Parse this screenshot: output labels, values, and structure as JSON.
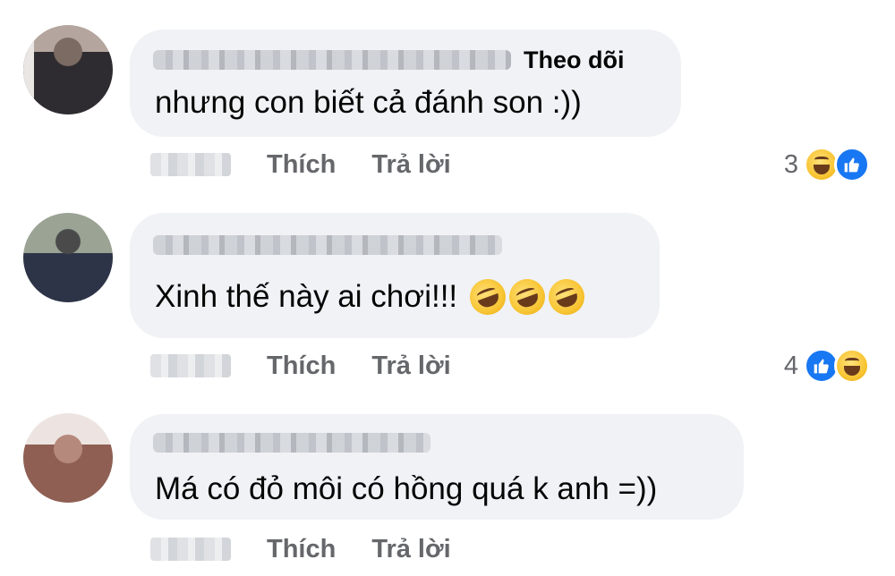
{
  "comments": [
    {
      "follow_label": "Theo dõi",
      "text": "nhưng con biết cả đánh son :))",
      "actions": {
        "like": "Thích",
        "reply": "Trả lời"
      },
      "reaction_count": "3",
      "reactions": [
        "haha-icon",
        "like-icon"
      ],
      "avatar_colors": [
        "#2b2a2e",
        "#6a5a52",
        "#bfb0a8"
      ]
    },
    {
      "text": "Xinh thế này ai chơi!!!",
      "emojis": [
        "rolling-laughing-icon",
        "rolling-laughing-icon",
        "rolling-laughing-icon"
      ],
      "actions": {
        "like": "Thích",
        "reply": "Trả lời"
      },
      "reaction_count": "4",
      "reactions": [
        "like-icon",
        "haha-icon"
      ],
      "avatar_colors": [
        "#8f9a88",
        "#2d3447",
        "#c9c7b8"
      ]
    },
    {
      "text": "Má có đỏ môi có hồng quá k anh =))",
      "actions": {
        "like": "Thích",
        "reply": "Trả lời"
      },
      "avatar_colors": [
        "#a7776a",
        "#e6dbd8",
        "#5b3b34"
      ]
    }
  ],
  "colors": {
    "bubble": "#f0f2f5",
    "action_text": "#65676b",
    "like_blue": "#1877f2"
  }
}
